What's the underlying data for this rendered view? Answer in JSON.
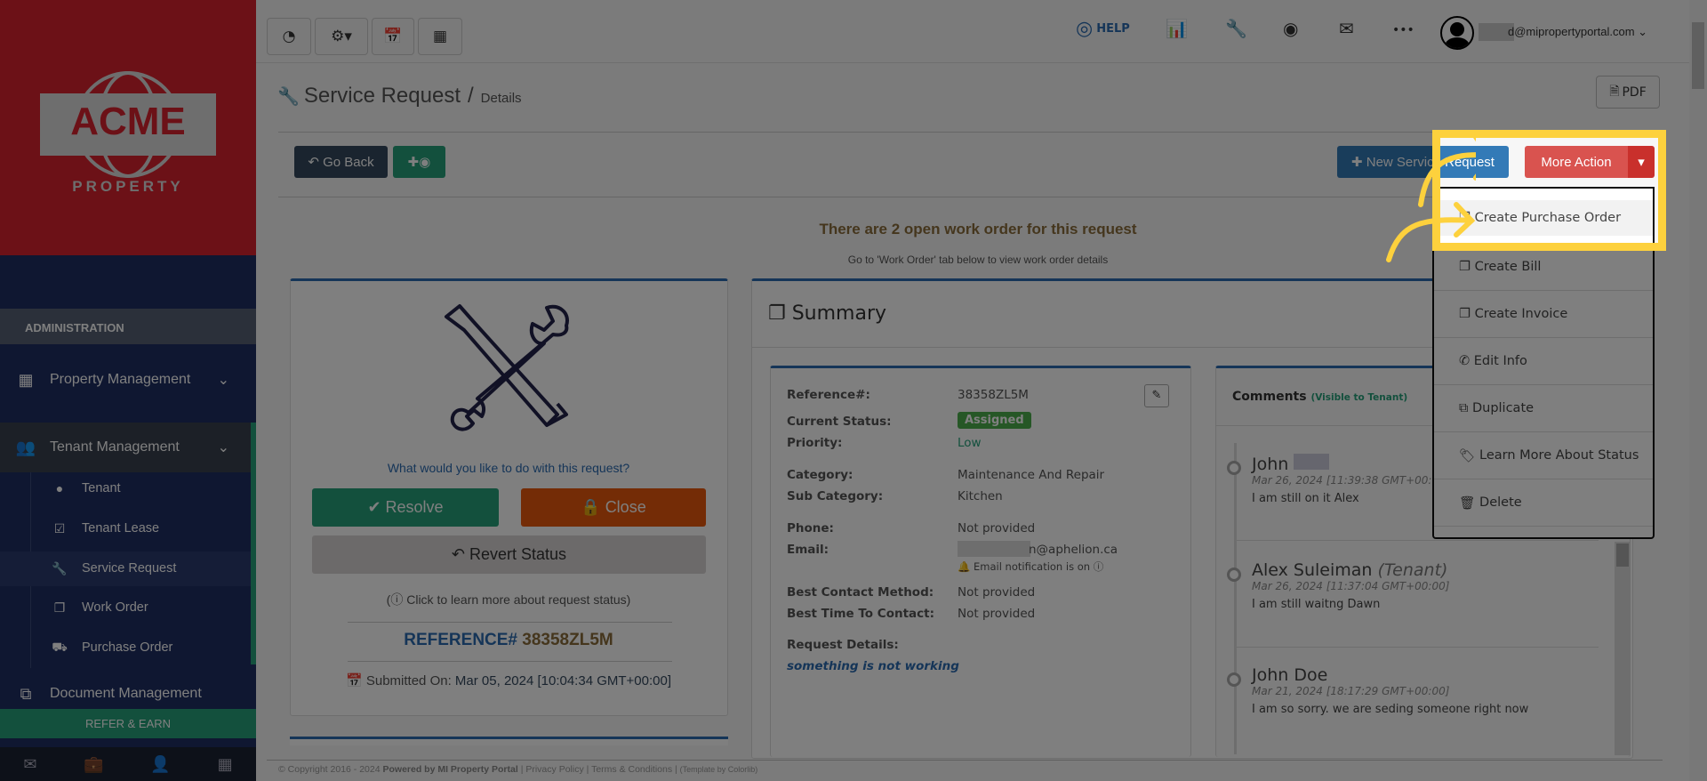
{
  "logo": {
    "brand": "ACME",
    "sub": "PROPERTY"
  },
  "sidebar": {
    "section": "ADMINISTRATION",
    "items": [
      {
        "label": "Property Management"
      },
      {
        "label": "Tenant Management"
      },
      {
        "label": "Tenant"
      },
      {
        "label": "Tenant Lease"
      },
      {
        "label": "Service Request"
      },
      {
        "label": "Work Order"
      },
      {
        "label": "Purchase Order"
      },
      {
        "label": "Document Management"
      }
    ],
    "refer": "REFER & EARN"
  },
  "topbar": {
    "help": "HELP",
    "user_email": "d@mipropertyportal.com"
  },
  "page": {
    "title": "Service Request",
    "separator": "/",
    "subtitle": "Details",
    "pdf": "PDF",
    "go_back": "Go Back",
    "new_request": "New Service Request",
    "more_action": "More Action"
  },
  "notice": {
    "heading": "There are 2 open work order for this request",
    "sub": "Go to 'Work Order' tab below to view work order details"
  },
  "actions": {
    "question": "What would you like to do with this request?",
    "resolve": "Resolve",
    "close": "Close",
    "revert": "Revert Status",
    "learn": "Click to learn more about request status)",
    "learn_open": "(",
    "ref_label": "REFERENCE#",
    "ref_value": "38358ZL5M",
    "submitted_label": "Submitted On:",
    "submitted_value": "Mar 05, 2024 [10:04:34 GMT+00:00]"
  },
  "summary": {
    "title": "Summary",
    "fields": [
      {
        "label": "Reference#:",
        "value": "38358ZL5M"
      },
      {
        "label": "Current Status:",
        "value": "Assigned"
      },
      {
        "label": "Priority:",
        "value": "Low"
      },
      {
        "label": "Category:",
        "value": "Maintenance And Repair"
      },
      {
        "label": "Sub Category:",
        "value": "Kitchen"
      },
      {
        "label": "Phone:",
        "value": "Not provided"
      },
      {
        "label": "Email:",
        "value": "n@aphelion.ca"
      },
      {
        "label": "Best Contact Method:",
        "value": "Not provided"
      },
      {
        "label": "Best Time To Contact:",
        "value": "Not provided"
      },
      {
        "label": "Request Details:",
        "value": "something is not working"
      }
    ],
    "email_note": "Email notification is on"
  },
  "comments": {
    "title": "Comments",
    "note": "(Visible to Tenant)",
    "items": [
      {
        "name": "John",
        "role": "",
        "date": "Mar 26, 2024 [11:39:38 GMT+00:00]",
        "text": "I am still on it Alex"
      },
      {
        "name": "Alex Suleiman",
        "role": "(Tenant)",
        "date": "Mar 26, 2024 [11:37:04 GMT+00:00]",
        "text": "I am still waitng Dawn"
      },
      {
        "name": "John Doe",
        "role": "",
        "date": "Mar 21, 2024 [18:17:29 GMT+00:00]",
        "text": "I am so sorry. we are seding someone right now"
      }
    ]
  },
  "dropdown": {
    "items": [
      {
        "label": "Create Purchase Order"
      },
      {
        "label": "Create Bill"
      },
      {
        "label": "Create Invoice"
      },
      {
        "label": "Edit Info"
      },
      {
        "label": "Duplicate"
      },
      {
        "label": "Learn More About Status"
      },
      {
        "label": "Delete"
      }
    ]
  },
  "footer": {
    "copyright": "© Copyright 2016 - 2024",
    "powered": "Powered by MI Property Portal",
    "links": "| Privacy Policy | Terms & Conditions |",
    "template": "(Template by Colorlib)"
  },
  "colors": {
    "brand_red": "#d9222e",
    "navy": "#1e2e62",
    "highlight": "#fdd13d",
    "green": "#26a17b",
    "orange": "#e8590c"
  }
}
